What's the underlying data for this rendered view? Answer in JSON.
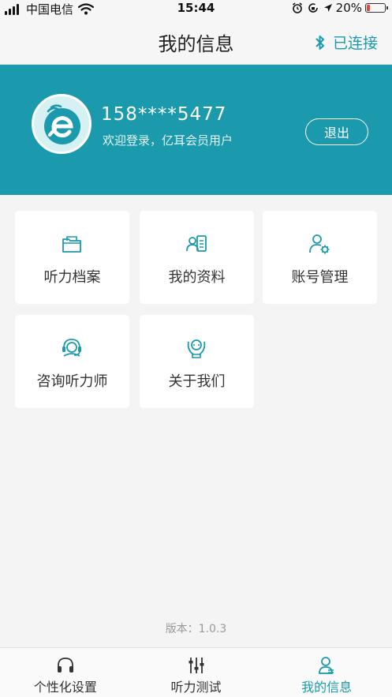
{
  "status_bar": {
    "carrier": "中国电信",
    "time": "15:44",
    "battery": "20%",
    "battery_level": 0.2
  },
  "header": {
    "title": "我的信息",
    "connection_status": "已连接"
  },
  "profile": {
    "phone": "158****5477",
    "welcome": "欢迎登录，亿耳会员用户",
    "logout_label": "退出"
  },
  "menu": {
    "items": [
      {
        "label": "听力档案",
        "icon": "folder-icon"
      },
      {
        "label": "我的资料",
        "icon": "profile-card-icon"
      },
      {
        "label": "账号管理",
        "icon": "user-settings-icon"
      },
      {
        "label": "咨询听力师",
        "icon": "headset-support-icon"
      },
      {
        "label": "关于我们",
        "icon": "about-us-icon"
      }
    ]
  },
  "version": "版本：1.0.3",
  "tab_bar": {
    "items": [
      {
        "label": "个性化设置",
        "icon": "headphones-icon",
        "active": false
      },
      {
        "label": "听力测试",
        "icon": "equalizer-icon",
        "active": false
      },
      {
        "label": "我的信息",
        "icon": "user-icon",
        "active": true
      }
    ]
  },
  "colors": {
    "accent": "#1a9aac",
    "background": "#f4f4f4",
    "card": "#ffffff",
    "battery_low": "#e8443a"
  }
}
